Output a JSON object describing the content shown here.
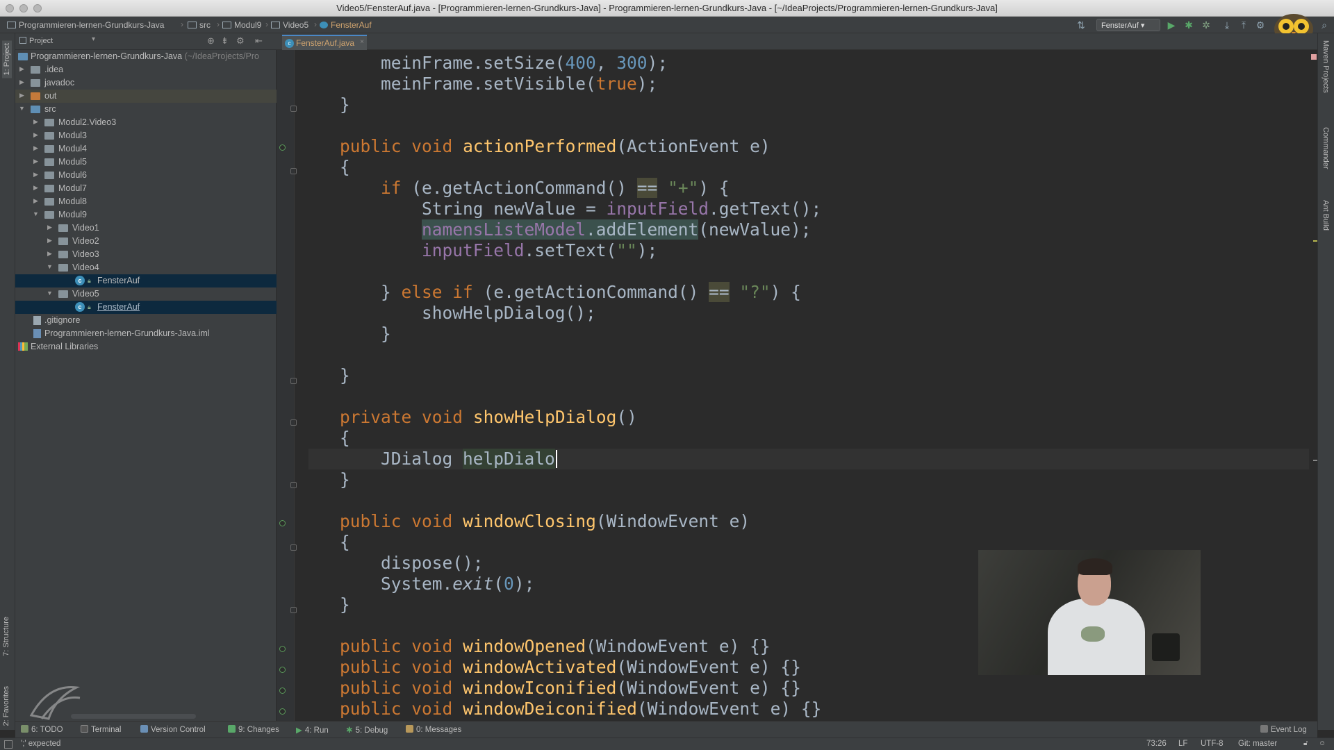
{
  "window": {
    "title": "Video5/FensterAuf.java - [Programmieren-lernen-Grundkurs-Java] - Programmieren-lernen-Grundkurs-Java - [~/IdeaProjects/Programmieren-lernen-Grundkurs-Java]"
  },
  "navbar": {
    "crumbs": [
      "Programmieren-lernen-Grundkurs-Java",
      "src",
      "Modul9",
      "Video5",
      "FensterAuf"
    ],
    "run_config": "FensterAuf"
  },
  "left_stripe": {
    "project_tab": "1: Project",
    "structure_tab": "7: Structure",
    "favorites_tab": "2: Favorites"
  },
  "right_stripe": {
    "maven_tab": "Maven Projects",
    "commander_tab": "Commander",
    "ant_tab": "Ant Build"
  },
  "project_panel": {
    "title": "Project",
    "tree": [
      {
        "label": "Programmieren-lernen-Grundkurs-Java",
        "suffix": " (~/IdeaProjects/Pro",
        "kind": "root"
      },
      {
        "label": ".idea",
        "kind": "folder"
      },
      {
        "label": "javadoc",
        "kind": "folder"
      },
      {
        "label": "out",
        "kind": "folder"
      },
      {
        "label": "src",
        "kind": "folder"
      },
      {
        "label": "Modul2.Video3",
        "kind": "folder"
      },
      {
        "label": "Modul3",
        "kind": "folder"
      },
      {
        "label": "Modul4",
        "kind": "folder"
      },
      {
        "label": "Modul5",
        "kind": "folder"
      },
      {
        "label": "Modul6",
        "kind": "folder"
      },
      {
        "label": "Modul7",
        "kind": "folder"
      },
      {
        "label": "Modul8",
        "kind": "folder"
      },
      {
        "label": "Modul9",
        "kind": "folder"
      },
      {
        "label": "Video1",
        "kind": "folder"
      },
      {
        "label": "Video2",
        "kind": "folder"
      },
      {
        "label": "Video3",
        "kind": "folder"
      },
      {
        "label": "Video4",
        "kind": "folder"
      },
      {
        "label": "FensterAuf",
        "kind": "java"
      },
      {
        "label": "Video5",
        "kind": "folder"
      },
      {
        "label": "FensterAuf",
        "kind": "java"
      },
      {
        "label": ".gitignore",
        "kind": "file"
      },
      {
        "label": "Programmieren-lernen-Grundkurs-Java.iml",
        "kind": "file"
      },
      {
        "label": "External Libraries",
        "kind": "libs"
      }
    ]
  },
  "editor": {
    "tab_label": "FensterAuf.java"
  },
  "code": {
    "l1": "meinFrame.setSize(",
    "l1_n1": "400",
    "l1_c": ", ",
    "l1_n2": "300",
    "l1_end": ");",
    "l2": "meinFrame.setVisible(",
    "l2_kw": "true",
    "l2_end": ");",
    "brace_close": "}",
    "brace_open": "{",
    "kw_public": "public",
    "kw_void": "void",
    "kw_private": "private",
    "kw_if": "if",
    "kw_else": "else",
    "m_actionPerformed": "actionPerformed",
    "p_action": "(ActionEvent e)",
    "if1_a": " (e.getActionCommand() ",
    "eq": "==",
    "if1_s": "\"+\"",
    "if1_b": ") {",
    "l_str": "String newValue = ",
    "f_input": "inputField",
    "l_gettext": ".getText();",
    "f_model": "namensListeModel",
    "l_add": ".addElement",
    "l_add_args": "(newValue);",
    "l_settext": ".setText(",
    "s_empty": "\"\"",
    "l_settext_end": ");",
    "elseif_a": "} ",
    "elseif_b": " (e.getActionCommand() ",
    "elseif_s": "\"?\"",
    "elseif_c": ") {",
    "call_help": "showHelpDialog();",
    "m_showHelp": "showHelpDialog",
    "p_empty": "()",
    "l_jdialog": "JDialog ",
    "l_jdialog_var": "helpDialo",
    "m_windowClosing": "windowClosing",
    "p_window": "(WindowEvent e)",
    "l_dispose": "dispose();",
    "l_system": "System.",
    "l_exit": "exit",
    "l_exit_open": "(",
    "n_zero": "0",
    "l_exit_close": ");",
    "m_windowOpened": "windowOpened",
    "m_windowActivated": "windowActivated",
    "m_windowIconified": "windowIconified",
    "m_windowDeiconified": "windowDeiconified",
    "p_window_empty": "(WindowEvent e) {}"
  },
  "bottom_bar": {
    "todo": "6: TODO",
    "terminal": "Terminal",
    "vcs": "Version Control",
    "changes": "9: Changes",
    "run": "4: Run",
    "debug": "5: Debug",
    "messages": "0: Messages",
    "event_log": "Event Log"
  },
  "status": {
    "message": "';' expected",
    "position": "73:26",
    "line_sep": "LF",
    "encoding": "UTF-8",
    "git": "Git: master"
  },
  "colors": {
    "keyword": "#cc7832",
    "method": "#ffc66d",
    "number": "#6897bb",
    "string": "#6a8759",
    "field": "#9876aa",
    "selection": "#0d293e"
  }
}
